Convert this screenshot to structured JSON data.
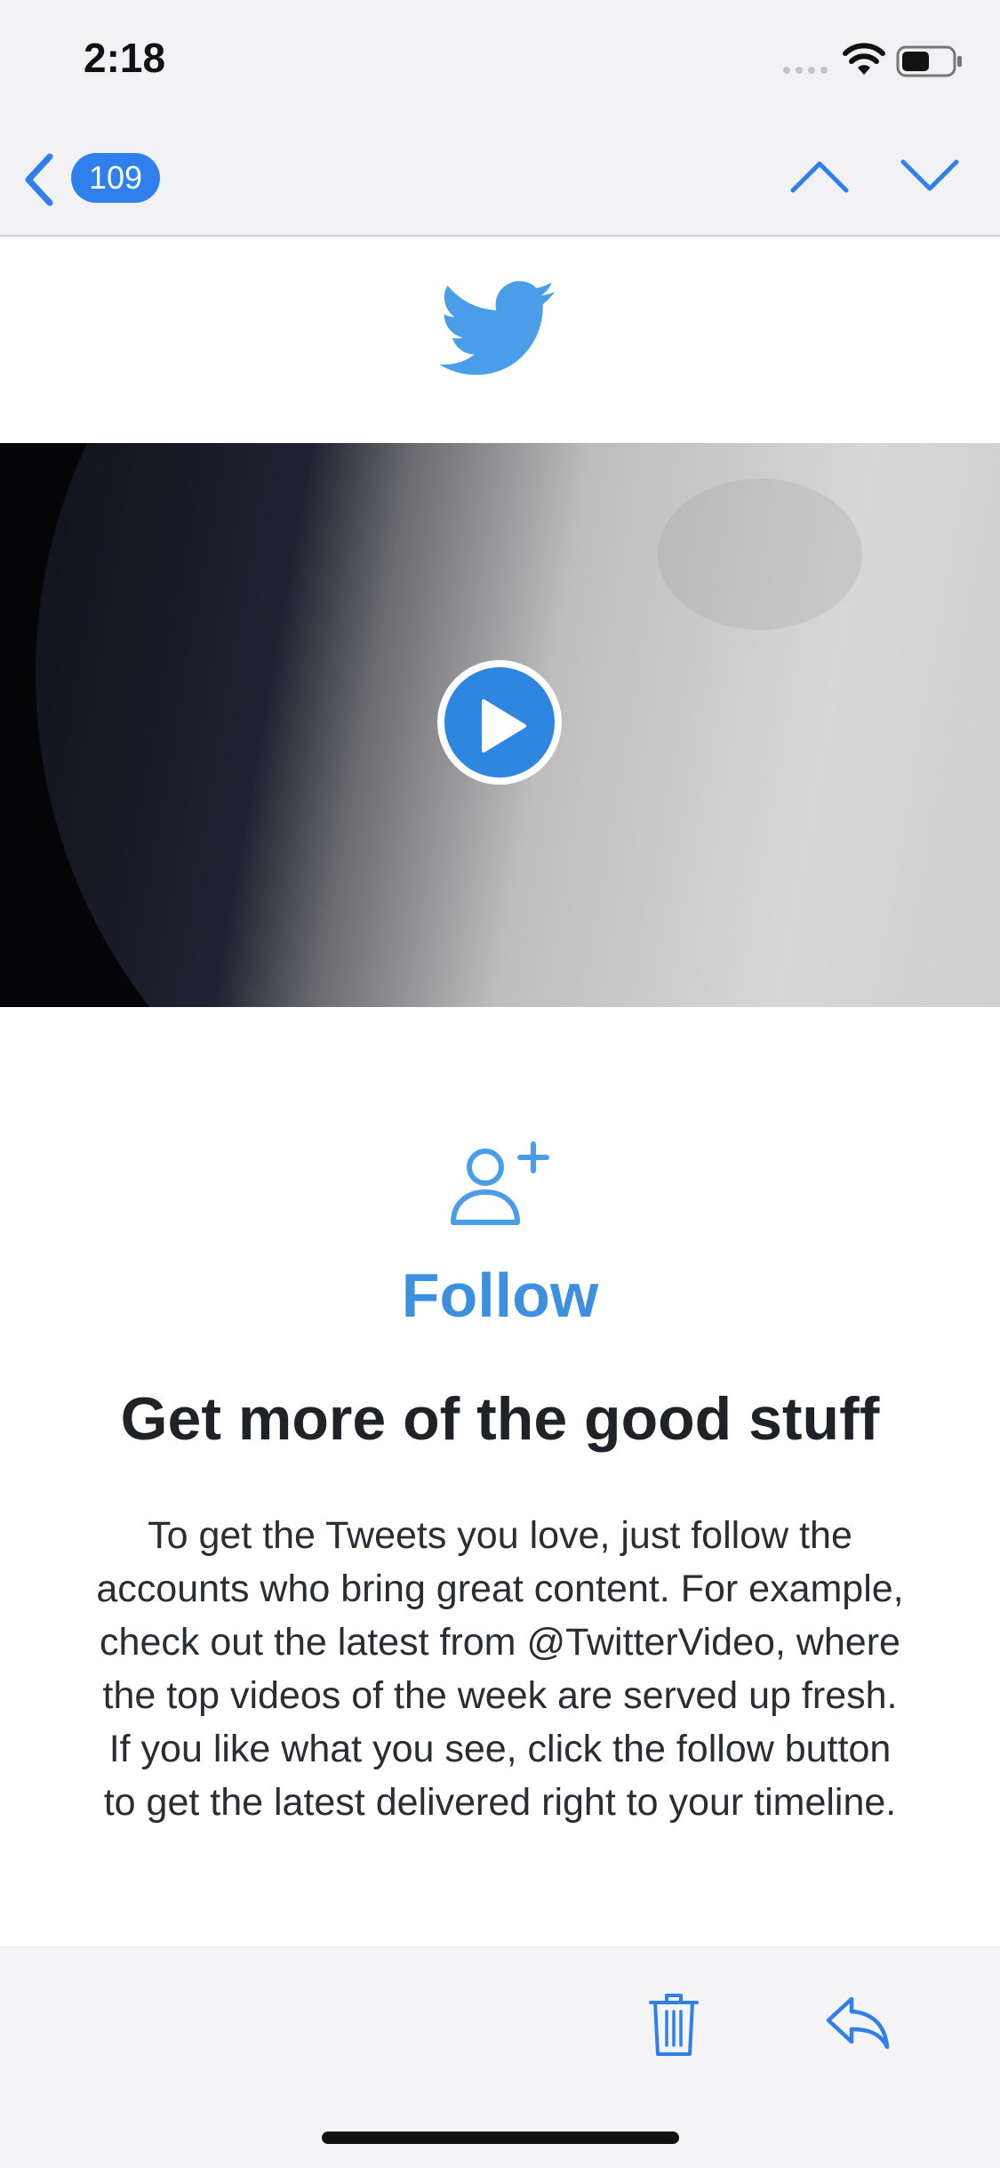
{
  "status_bar": {
    "time": "2:18"
  },
  "nav": {
    "back_count": "109"
  },
  "email": {
    "video": {
      "description": "moon video thumbnail"
    },
    "follow_label": "Follow",
    "headline": "Get more of the good stuff",
    "body": "To get the Tweets you love, just follow the accounts who bring great content. For example, check out the latest from @TwitterVideo, where the top videos of the week are served up fresh. If you like what you see, click the follow button to get the latest delivered right to your timeline."
  },
  "icons": {
    "back": "chevron-left-icon",
    "up": "chevron-up-icon",
    "down": "chevron-down-icon",
    "logo": "twitter-bird-icon",
    "play": "play-icon",
    "follow": "add-user-icon",
    "trash": "trash-icon",
    "reply": "reply-icon"
  },
  "colors": {
    "accent": "#2f80ed",
    "twitter_blue": "#4a9de8",
    "headline": "#1f2226"
  }
}
